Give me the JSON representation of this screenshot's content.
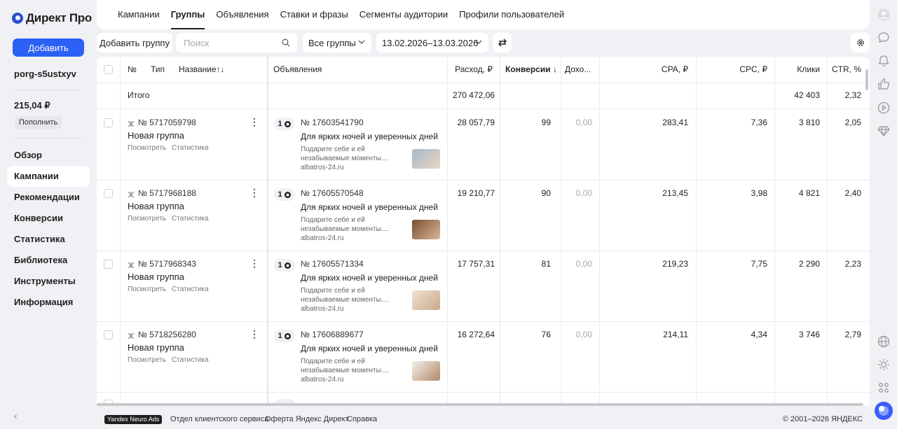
{
  "sidebar": {
    "logo_text": "Директ Про",
    "add_button": "Добавить",
    "login": "porg-s5ustxyv",
    "balance": "215,04 ₽",
    "topup_button": "Пополнить",
    "nav": [
      {
        "label": "Обзор",
        "active": false
      },
      {
        "label": "Кампании",
        "active": true
      },
      {
        "label": "Рекомендации",
        "active": false
      },
      {
        "label": "Конверсии",
        "active": false
      },
      {
        "label": "Статистика",
        "active": false
      },
      {
        "label": "Библиотека",
        "active": false
      },
      {
        "label": "Инструменты",
        "active": false
      },
      {
        "label": "Информация",
        "active": false
      }
    ]
  },
  "tabs": [
    "Кампании",
    "Группы",
    "Объявления",
    "Ставки и фразы",
    "Сегменты аудитории",
    "Профили пользователей"
  ],
  "active_tab": "Группы",
  "toolbar": {
    "add_group": "Добавить группу",
    "search_placeholder": "Поиск",
    "groups_filter": "Все группы",
    "date_range": "13.02.2026–13.03.2026"
  },
  "table": {
    "headers": {
      "num": "№",
      "type": "Тип",
      "name": "Название↑↓",
      "ads": "Объявления",
      "spend": "Расход, ₽",
      "conversions": "Конверсии ↓",
      "income": "Дохо...",
      "cpa": "CPA, ₽",
      "cpc": "CPC, ₽",
      "clicks": "Клики",
      "ctr": "CTR, %"
    },
    "total": {
      "label": "Итого",
      "spend": "270 472,06",
      "clicks": "42 403",
      "ctr": "2,32"
    },
    "rows": [
      {
        "id": "№ 5717059798",
        "name": "Новая группа",
        "view": "Посмотреть",
        "stats": "Статистика",
        "ad_count": "1",
        "ad_id": "№ 17603541790",
        "ad_title": "Для ярких ночей и уверенных дней",
        "ad_desc": "Подарите себе и ей незабываемые моменты....",
        "ad_domain": "albatros-24.ru",
        "spend": "28 057,79",
        "conv": "99",
        "income": "0,00",
        "cpa": "283,41",
        "cpc": "7,36",
        "clicks": "3 810",
        "ctr": "2,05"
      },
      {
        "id": "№ 5717968188",
        "name": "Новая группа",
        "view": "Посмотреть",
        "stats": "Статистика",
        "ad_count": "1",
        "ad_id": "№ 17605570548",
        "ad_title": "Для ярких ночей и уверенных дней",
        "ad_desc": "Подарите себе и ей незабываемые моменты....",
        "ad_domain": "albatros-24.ru",
        "spend": "19 210,77",
        "conv": "90",
        "income": "0,00",
        "cpa": "213,45",
        "cpc": "3,98",
        "clicks": "4 821",
        "ctr": "2,40"
      },
      {
        "id": "№ 5717968343",
        "name": "Новая группа",
        "view": "Посмотреть",
        "stats": "Статистика",
        "ad_count": "1",
        "ad_id": "№ 17605571334",
        "ad_title": "Для ярких ночей и уверенных дней",
        "ad_desc": "Подарите себе и ей незабываемые моменты....",
        "ad_domain": "albatros-24.ru",
        "spend": "17 757,31",
        "conv": "81",
        "income": "0,00",
        "cpa": "219,23",
        "cpc": "7,75",
        "clicks": "2 290",
        "ctr": "2,23"
      },
      {
        "id": "№ 5718256280",
        "name": "Новая группа",
        "view": "Посмотреть",
        "stats": "Статистика",
        "ad_count": "1",
        "ad_id": "№ 17606889677",
        "ad_title": "Для ярких ночей и уверенных дней",
        "ad_desc": "Подарите себе и ей незабываемые моменты....",
        "ad_domain": "albatros-24.ru",
        "spend": "16 272,64",
        "conv": "76",
        "income": "0,00",
        "cpa": "214,11",
        "cpc": "4,34",
        "clicks": "3 746",
        "ctr": "2,79"
      }
    ]
  },
  "footer": {
    "badge": "Yandex Neuro Ads",
    "link_support": "Отдел клиентского сервиса",
    "link_offer": "Оферта Яндекс Директ",
    "link_help": "Справка",
    "copyright": "© 2001–2026 ЯНДЕКС"
  },
  "colors": {
    "accent": "#2b61f5",
    "background": "#f0f1f4"
  },
  "right_rail_icons": [
    "avatar-icon",
    "chat-icon",
    "bell-icon",
    "thumbs-up-icon",
    "play-icon",
    "diamond-icon",
    "globe-icon",
    "sun-icon",
    "apps-icon",
    "assistant-icon"
  ]
}
